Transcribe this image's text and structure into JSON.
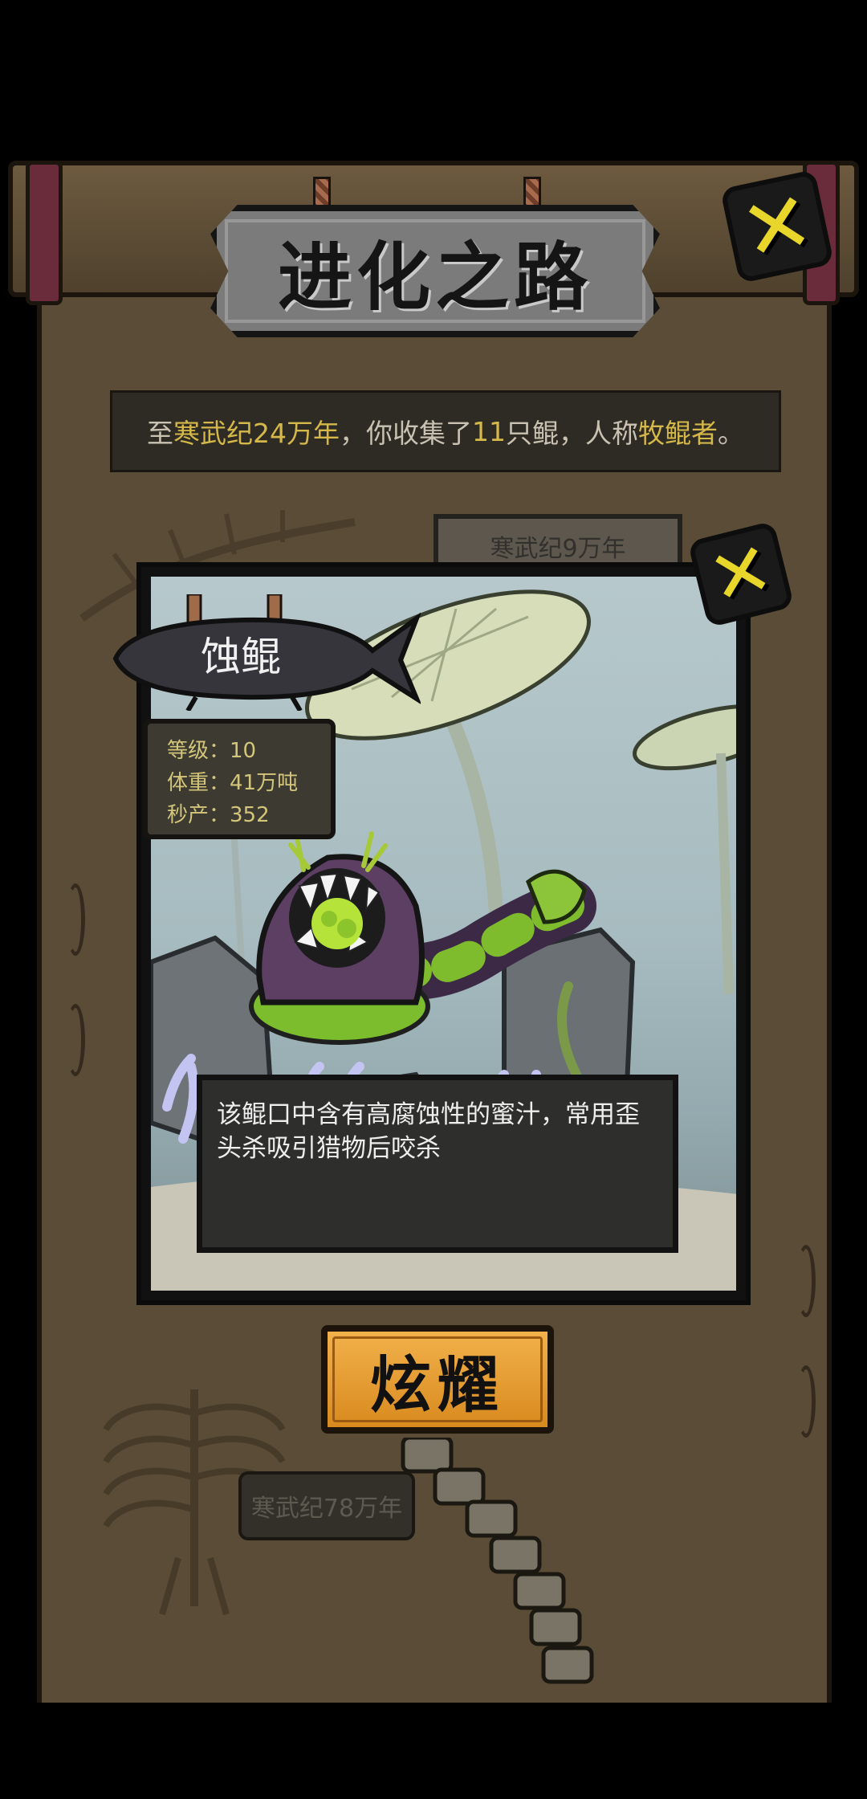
{
  "header": {
    "title": "进化之路"
  },
  "summary": {
    "prefix": "至",
    "era": "寒武纪24万年",
    "mid": "，你收集了",
    "count": "11",
    "mid2": "只鲲，人称",
    "rank": "牧鲲者",
    "suffix": "。"
  },
  "background_labels": {
    "era_top": "寒武纪9万年",
    "era_bottom": "寒武纪78万年"
  },
  "creature": {
    "name": "蚀鲲",
    "stats": {
      "level_label": "等级：",
      "level": "10",
      "weight_label": "体重：",
      "weight": "41万吨",
      "output_label": "秒产：",
      "output": "352"
    },
    "description": "该鲲口中含有高腐蚀性的蜜汁，常用歪头杀吸引猎物后咬杀"
  },
  "buttons": {
    "show_off": "炫耀"
  },
  "colors": {
    "highlight": "#d5b84a",
    "close_icon": "#e8d62a",
    "button": "#e59c2f",
    "parchment": "#5b4c37"
  }
}
